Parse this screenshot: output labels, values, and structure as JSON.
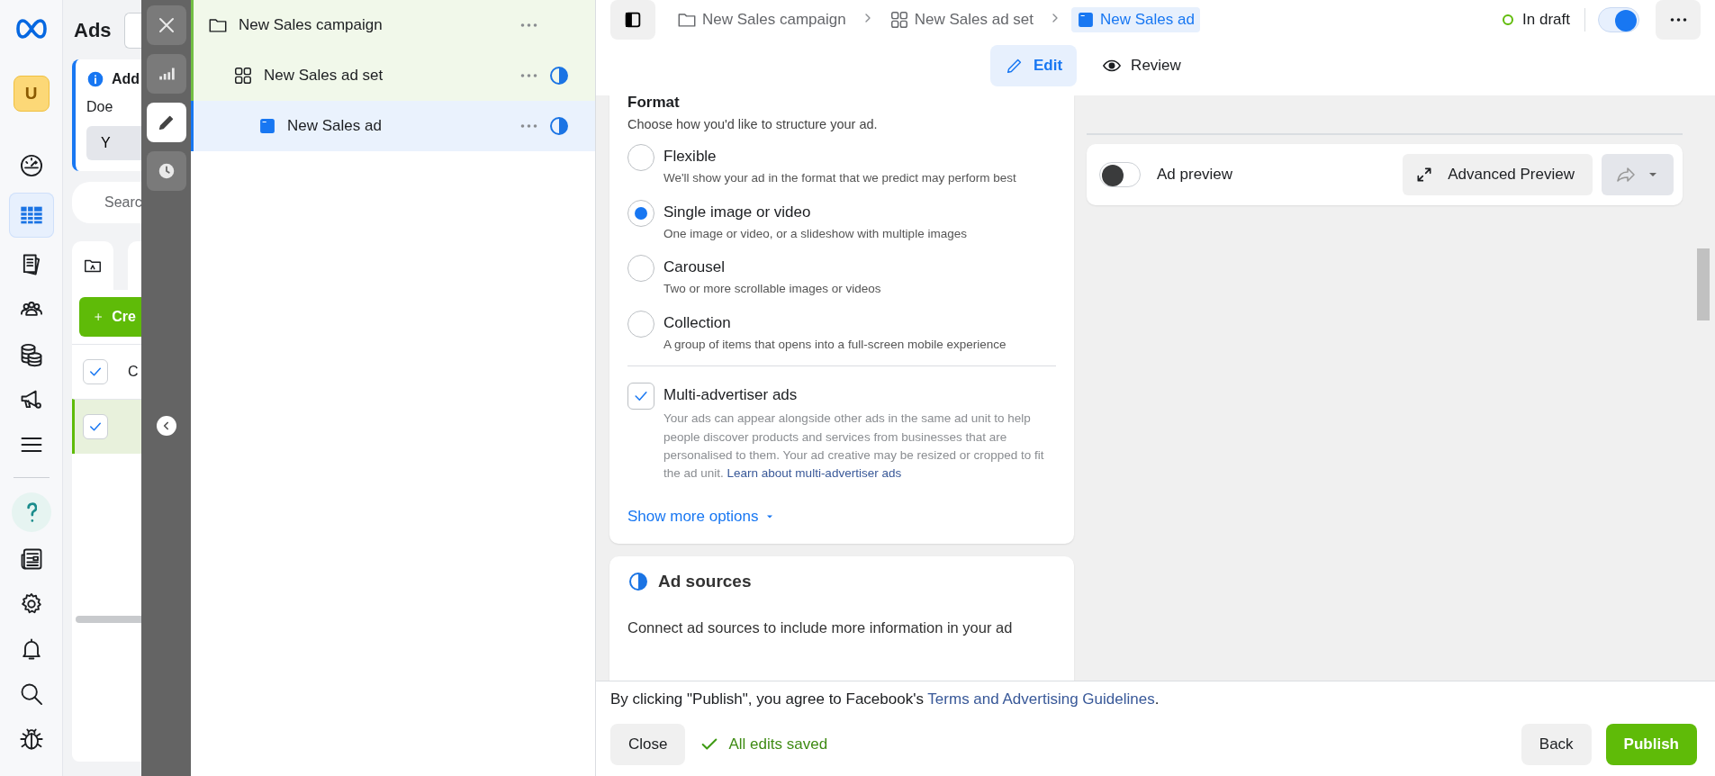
{
  "nav_rail": {
    "avatar": "U",
    "items": [
      {
        "kind": "gauge",
        "selected": false
      },
      {
        "kind": "table",
        "selected": true
      },
      {
        "kind": "pages",
        "selected": false
      },
      {
        "kind": "people",
        "selected": false
      },
      {
        "kind": "coins",
        "selected": false
      },
      {
        "kind": "megaphone",
        "selected": false
      },
      {
        "kind": "menu",
        "selected": false
      }
    ],
    "bottom_items": [
      {
        "kind": "help",
        "selected": false
      },
      {
        "kind": "news",
        "selected": false
      },
      {
        "kind": "settings",
        "selected": false
      },
      {
        "kind": "bell",
        "selected": false
      },
      {
        "kind": "search",
        "selected": false
      },
      {
        "kind": "bug",
        "selected": false
      }
    ]
  },
  "background_page": {
    "title": "Ads",
    "notice": {
      "title": "Add",
      "body": "Doe",
      "button": "Y"
    },
    "search": {
      "placeholder": "Searc"
    },
    "create_button": "Cre",
    "table": {
      "header_cell": "C",
      "rows": [
        {
          "checked": true,
          "highlighted": false
        },
        {
          "checked": true,
          "highlighted": true
        }
      ]
    }
  },
  "side_toolbar": {
    "buttons": [
      {
        "kind": "close",
        "selected": false
      },
      {
        "kind": "chart",
        "selected": false
      },
      {
        "kind": "edit",
        "selected": true
      },
      {
        "kind": "history",
        "selected": false
      }
    ]
  },
  "tree": {
    "items": [
      {
        "kind": "campaign",
        "label": "New Sales campaign",
        "selected": false,
        "incomplete": false,
        "children": [
          {
            "kind": "ad_set",
            "label": "New Sales ad set",
            "selected": false,
            "incomplete": true,
            "children": [
              {
                "kind": "ad",
                "label": "New Sales ad",
                "selected": true,
                "incomplete": true
              }
            ]
          }
        ]
      }
    ]
  },
  "breadcrumb": [
    {
      "kind": "campaign",
      "label": "New Sales campaign",
      "selected": false
    },
    {
      "kind": "ad_set",
      "label": "New Sales ad set",
      "selected": false
    },
    {
      "kind": "ad",
      "label": "New Sales ad",
      "selected": true
    }
  ],
  "status": {
    "label": "In draft",
    "on": true
  },
  "tabs": [
    {
      "kind": "edit",
      "label": "Edit",
      "selected": true
    },
    {
      "kind": "review",
      "label": "Review",
      "selected": false
    }
  ],
  "format": {
    "title": "Format",
    "subtitle": "Choose how you'd like to structure your ad.",
    "options": [
      {
        "label": "Flexible",
        "description": "We'll show your ad in the format that we predict may perform best",
        "selected": false
      },
      {
        "label": "Single image or video",
        "description": "One image or video, or a slideshow with multiple images",
        "selected": true
      },
      {
        "label": "Carousel",
        "description": "Two or more scrollable images or videos",
        "selected": false
      },
      {
        "label": "Collection",
        "description": "A group of items that opens into a full-screen mobile experience",
        "selected": false
      }
    ],
    "multi_advertiser": {
      "label": "Multi-advertiser ads",
      "checked": true,
      "description": "Your ads can appear alongside other ads in the same ad unit to help people discover products and services from businesses that are personalised to them. Your ad creative may be resized or cropped to fit the ad unit. ",
      "link": "Learn about multi-advertiser ads"
    },
    "show_more": "Show more options"
  },
  "ad_sources": {
    "title": "Ad sources",
    "body": "Connect ad sources to include more information in your ad"
  },
  "preview": {
    "label": "Ad preview",
    "on": false,
    "advanced_button": "Advanced Preview"
  },
  "footer": {
    "notice": "By clicking \"Publish\", you agree to Facebook's ",
    "link": "Terms and Advertising Guidelines",
    "notice_end": ".",
    "close": "Close",
    "saved": "All edits saved",
    "back": "Back",
    "publish": "Publish"
  }
}
